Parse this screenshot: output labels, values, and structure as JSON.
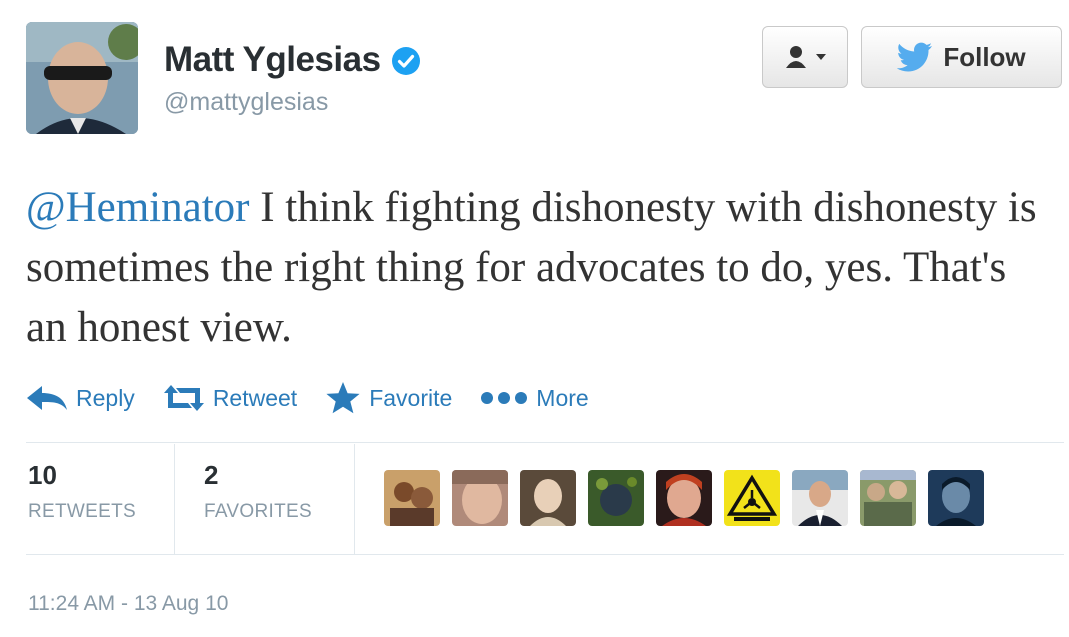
{
  "user": {
    "name": "Matt Yglesias",
    "handle": "@mattyglesias"
  },
  "header": {
    "follow_label": "Follow"
  },
  "tweet": {
    "mention": "@Heminator",
    "text": " I think fighting dishonesty with dishonesty is sometimes the right thing for advocates to do, yes. That's an honest view."
  },
  "actions": {
    "reply": "Reply",
    "retweet": "Retweet",
    "favorite": "Favorite",
    "more": "More"
  },
  "stats": {
    "retweets": {
      "count": "10",
      "label": "RETWEETS"
    },
    "favorites": {
      "count": "2",
      "label": "FAVORITES"
    }
  },
  "favoriters": [
    {
      "name": "faver-1",
      "color": "#a8744a"
    },
    {
      "name": "faver-2",
      "color": "#c9a08a"
    },
    {
      "name": "faver-3",
      "color": "#8a7b6a"
    },
    {
      "name": "faver-4",
      "color": "#4a6a2a"
    },
    {
      "name": "faver-5",
      "color": "#b53a2a"
    },
    {
      "name": "faver-6",
      "color": "#f2e21a"
    },
    {
      "name": "faver-7",
      "color": "#d9d9d9"
    },
    {
      "name": "faver-8",
      "color": "#7a8a5a"
    },
    {
      "name": "faver-9",
      "color": "#2a4a6a"
    }
  ],
  "timestamp": "11:24 AM - 13 Aug 10",
  "colors": {
    "link": "#2b7bb9",
    "verified": "#1da1f2",
    "twitter_bird": "#55acee"
  }
}
